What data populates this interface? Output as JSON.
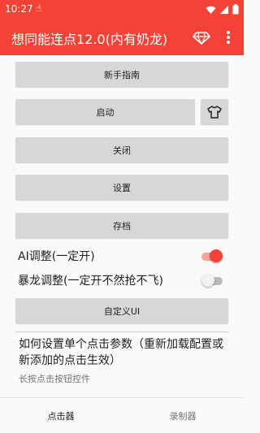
{
  "status": {
    "time": "10:27",
    "hand_icon": "touch-icon"
  },
  "app_bar": {
    "title": "想同能连点12.0(内有奶龙)",
    "color": "#f44336"
  },
  "buttons": {
    "guide": "新手指南",
    "start": "启动",
    "close": "关闭",
    "settings": "设置",
    "save": "存档",
    "custom_ui": "自定义UI"
  },
  "switches": [
    {
      "label": "AI调整(一定开)",
      "checked": true
    },
    {
      "label": "暴龙调整(一定开不然抢不飞)",
      "checked": false
    }
  ],
  "info": {
    "title": "如何设置单个点击参数（重新加载配置或新添加的点击生效）",
    "subtitle": "长按点击按钮控件"
  },
  "bottom_nav": {
    "tab1": "点击器",
    "tab2": "录制器"
  },
  "colors": {
    "accent": "#f44336",
    "button": "#d6d7d7"
  }
}
